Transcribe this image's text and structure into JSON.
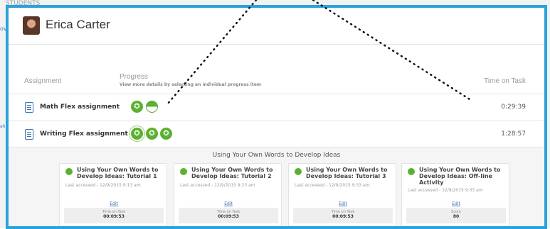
{
  "background": {
    "top_text": "STUDENTS",
    "side_text_a": "ov",
    "side_text_b": "ah"
  },
  "header": {
    "user_name": "Erica Carter"
  },
  "columns": {
    "assignment": "Assignment",
    "progress": "Progress",
    "progress_hint": "View more details by selecting an individual progress item",
    "time_on_task": "Time on Task"
  },
  "rows": [
    {
      "title": "Math Flex assignment",
      "time": "0:29:39",
      "badges": [
        "star",
        "half"
      ]
    },
    {
      "title": "Writing Flex assignment",
      "time": "1:28:57",
      "badges": [
        "star",
        "star",
        "star"
      ]
    }
  ],
  "badge_glyph": "✪",
  "detail": {
    "title": "Using Your Own Words to Develop Ideas",
    "edit_label": "Edit",
    "cards": [
      {
        "title": "Using Your Own Words to Develop Ideas: Tutorial 1",
        "accessed": "Last accessed - 12/9/2015 9:13 am",
        "stat_label": "Time on Task",
        "stat_value": "00:09:53"
      },
      {
        "title": "Using Your Own Words to Develop Ideas: Tutorial 2",
        "accessed": "Last accessed - 12/9/2015 9:23 am",
        "stat_label": "Time on Task",
        "stat_value": "00:09:53"
      },
      {
        "title": "Using Your Own Words to Develop Ideas: Tutorial 3",
        "accessed": "Last accessed - 12/9/2015 9:33 am",
        "stat_label": "Time on Task",
        "stat_value": "00:09:53"
      },
      {
        "title": "Using Your Own Words to Develop Ideas: Off-line Activity",
        "accessed": "Last accessed - 12/9/2015 9:33 am",
        "stat_label": "Score",
        "stat_value": "80"
      }
    ]
  },
  "colors": {
    "frame": "#2aa3dc",
    "complete": "#5cb030",
    "link": "#3b6fb5"
  }
}
